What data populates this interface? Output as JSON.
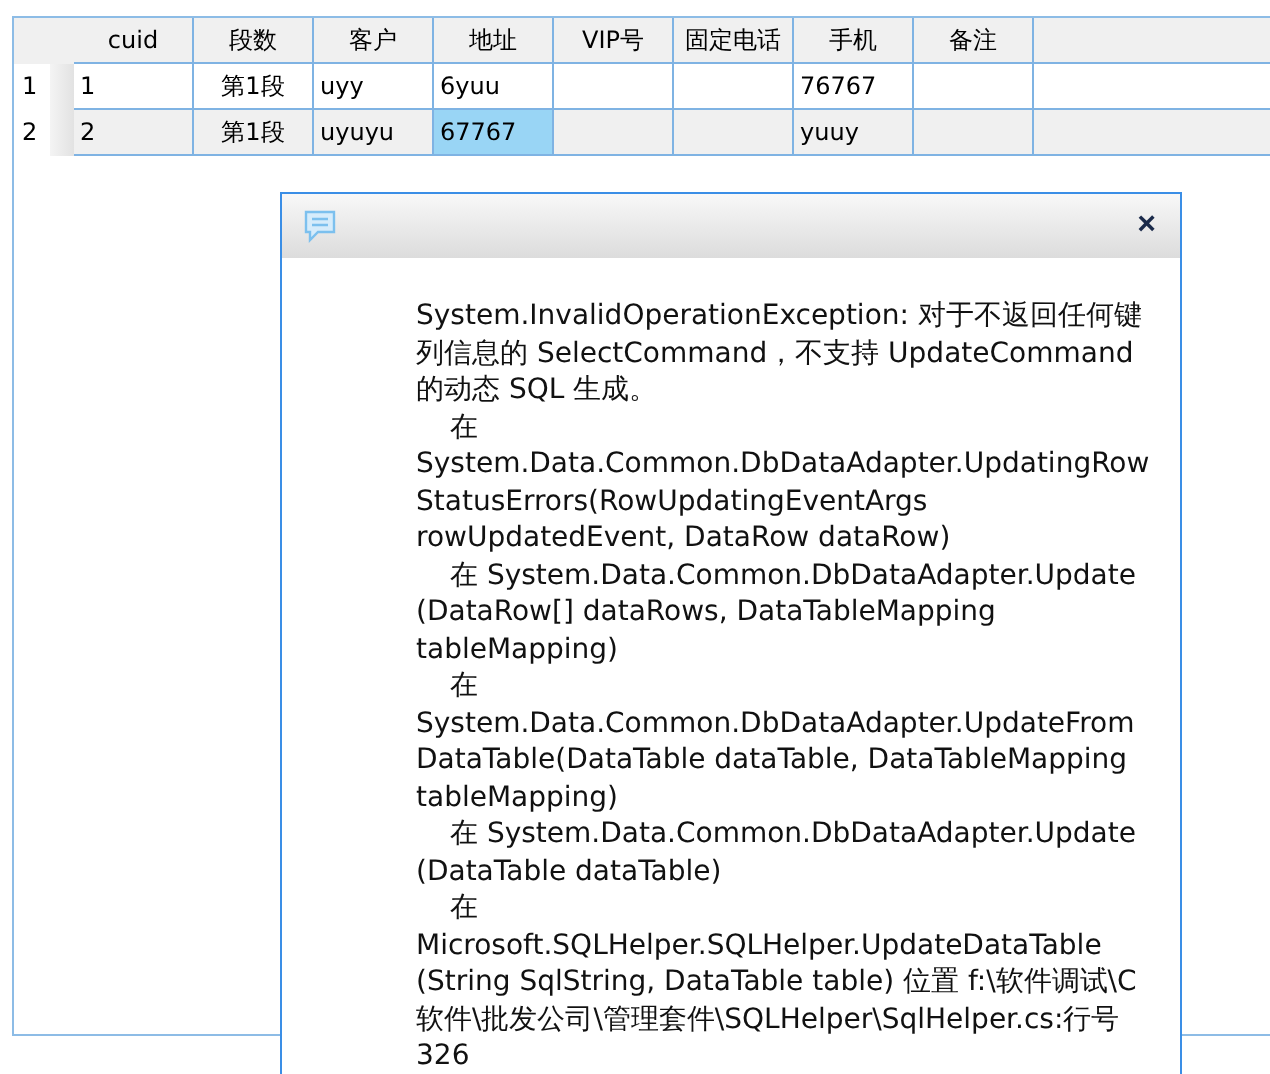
{
  "table": {
    "columns": [
      "cuid",
      "段数",
      "客户",
      "地址",
      "VIP号",
      "固定电话",
      "手机",
      "备注"
    ],
    "rows": [
      {
        "number": "1",
        "selected": false,
        "cells": [
          {
            "text": "1",
            "selected": false
          },
          {
            "text": "第1段",
            "selected": false
          },
          {
            "text": "uyy",
            "selected": false
          },
          {
            "text": "6yuu",
            "selected": false
          },
          null,
          null,
          {
            "text": "76767",
            "selected": false
          },
          null
        ]
      },
      {
        "number": "2",
        "selected": true,
        "cells": [
          {
            "text": "2",
            "selected": false
          },
          {
            "text": "第1段",
            "selected": false
          },
          {
            "text": "uyuyu",
            "selected": false
          },
          {
            "text": "67767",
            "selected": true
          },
          null,
          null,
          {
            "text": "yuuy",
            "selected": false
          },
          null
        ]
      }
    ]
  },
  "dialog": {
    "close": "×",
    "message_lines": [
      {
        "text": "System.InvalidOperationException: 对于不返回任何键",
        "indented": false
      },
      {
        "text": "列信息的 SelectCommand，不支持 UpdateCommand",
        "indented": false
      },
      {
        "text": "的动态 SQL 生成。",
        "indented": false
      },
      {
        "text": "在",
        "indented": true
      },
      {
        "text": "System.Data.Common.DbDataAdapter.UpdatingRow",
        "indented": false
      },
      {
        "text": "StatusErrors(RowUpdatingEventArgs",
        "indented": false
      },
      {
        "text": "rowUpdatedEvent, DataRow dataRow)",
        "indented": false
      },
      {
        "text": "在 System.Data.Common.DbDataAdapter.Update",
        "indented": true
      },
      {
        "text": "(DataRow[] dataRows, DataTableMapping",
        "indented": false
      },
      {
        "text": "tableMapping)",
        "indented": false
      },
      {
        "text": "在",
        "indented": true
      },
      {
        "text": "System.Data.Common.DbDataAdapter.UpdateFrom",
        "indented": false
      },
      {
        "text": "DataTable(DataTable dataTable, DataTableMapping",
        "indented": false
      },
      {
        "text": "tableMapping)",
        "indented": false
      },
      {
        "text": "在 System.Data.Common.DbDataAdapter.Update",
        "indented": true
      },
      {
        "text": "(DataTable dataTable)",
        "indented": false
      },
      {
        "text": "在",
        "indented": true
      },
      {
        "text": "Microsoft.SQLHelper.SQLHelper.UpdateDataTable",
        "indented": false
      },
      {
        "text": "(String SqlString, DataTable table) 位置 f:\\软件调试\\C",
        "indented": false
      },
      {
        "text": "软件\\批发公司\\管理套件\\SQLHelper\\SqlHelper.cs:行号",
        "indented": false
      },
      {
        "text": "326",
        "indented": false
      }
    ]
  }
}
